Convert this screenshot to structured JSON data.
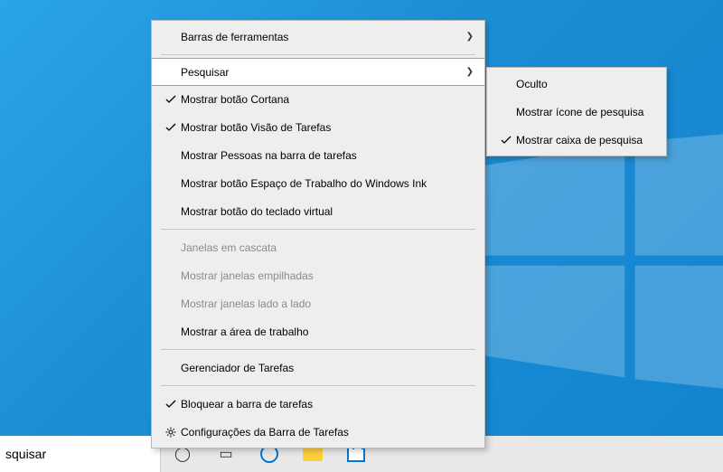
{
  "context_menu": {
    "items": [
      {
        "label": "Barras de ferramentas",
        "type": "submenu"
      },
      {
        "type": "separator"
      },
      {
        "label": "Pesquisar",
        "type": "submenu",
        "highlighted": true
      },
      {
        "label": "Mostrar botão Cortana",
        "checked": true
      },
      {
        "label": "Mostrar botão Visão de Tarefas",
        "checked": true
      },
      {
        "label": "Mostrar Pessoas na barra de tarefas"
      },
      {
        "label": "Mostrar botão Espaço de Trabalho do Windows Ink"
      },
      {
        "label": "Mostrar botão do teclado virtual"
      },
      {
        "type": "separator"
      },
      {
        "label": "Janelas em cascata",
        "disabled": true
      },
      {
        "label": "Mostrar janelas empilhadas",
        "disabled": true
      },
      {
        "label": "Mostrar janelas lado a lado",
        "disabled": true
      },
      {
        "label": "Mostrar a área de trabalho"
      },
      {
        "type": "separator"
      },
      {
        "label": "Gerenciador de Tarefas"
      },
      {
        "type": "separator"
      },
      {
        "label": "Bloquear a barra de tarefas",
        "checked": true
      },
      {
        "label": "Configurações da Barra de Tarefas",
        "icon": "gear"
      }
    ]
  },
  "submenu_search": {
    "items": [
      {
        "label": "Oculto"
      },
      {
        "label": "Mostrar ícone de pesquisa"
      },
      {
        "label": "Mostrar caixa de pesquisa",
        "checked": true
      }
    ]
  },
  "taskbar": {
    "search_text": "squisar"
  }
}
